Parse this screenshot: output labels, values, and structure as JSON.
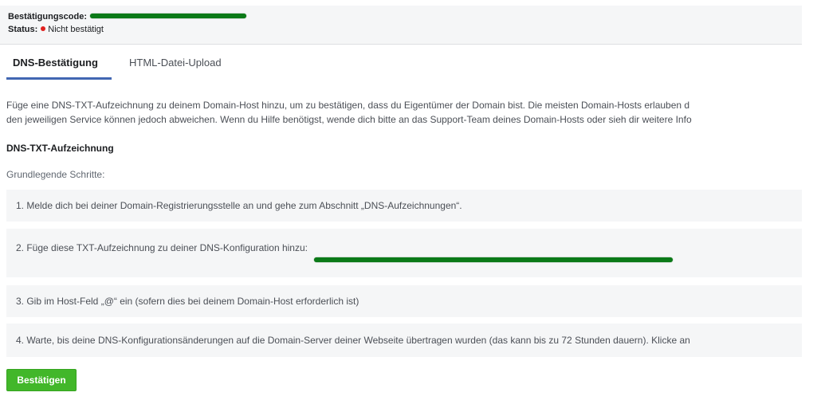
{
  "status": {
    "code_label": "Bestätigungscode:",
    "status_label": "Status:",
    "status_value": "Nicht bestätigt",
    "status_color": "#e0201e"
  },
  "tabs": [
    {
      "label": "DNS-Bestätigung",
      "active": true
    },
    {
      "label": "HTML-Datei-Upload",
      "active": false
    }
  ],
  "intro": {
    "line1": "Füge eine DNS-TXT-Aufzeichnung zu deinem Domain-Host hinzu, um zu bestätigen, dass du Eigentümer der Domain bist. Die meisten Domain-Hosts erlauben d",
    "line2": "den jeweiligen Service können jedoch abweichen. Wenn du Hilfe benötigst, wende dich bitte an das Support-Team deines Domain-Hosts oder sieh dir weitere Info"
  },
  "section_heading": "DNS-TXT-Aufzeichnung",
  "steps_label": "Grundlegende Schritte:",
  "steps": [
    "1. Melde dich bei deiner Domain-Registrierungsstelle an und gehe zum Abschnitt „DNS-Aufzeichnungen“.",
    "2. Füge diese TXT-Aufzeichnung zu deiner DNS-Konfiguration hinzu:",
    "3. Gib im Host-Feld „@“ ein (sofern dies bei deinem Domain-Host erforderlich ist)",
    "4. Warte, bis deine DNS-Konfigurationsänderungen auf die Domain-Server deiner Webseite übertragen wurden (das kann bis zu 72 Stunden dauern). Klicke an"
  ],
  "confirm_button": "Bestätigen",
  "colors": {
    "accent": "#4267b2",
    "button": "#42b72a",
    "redaction": "#0b7a18"
  }
}
